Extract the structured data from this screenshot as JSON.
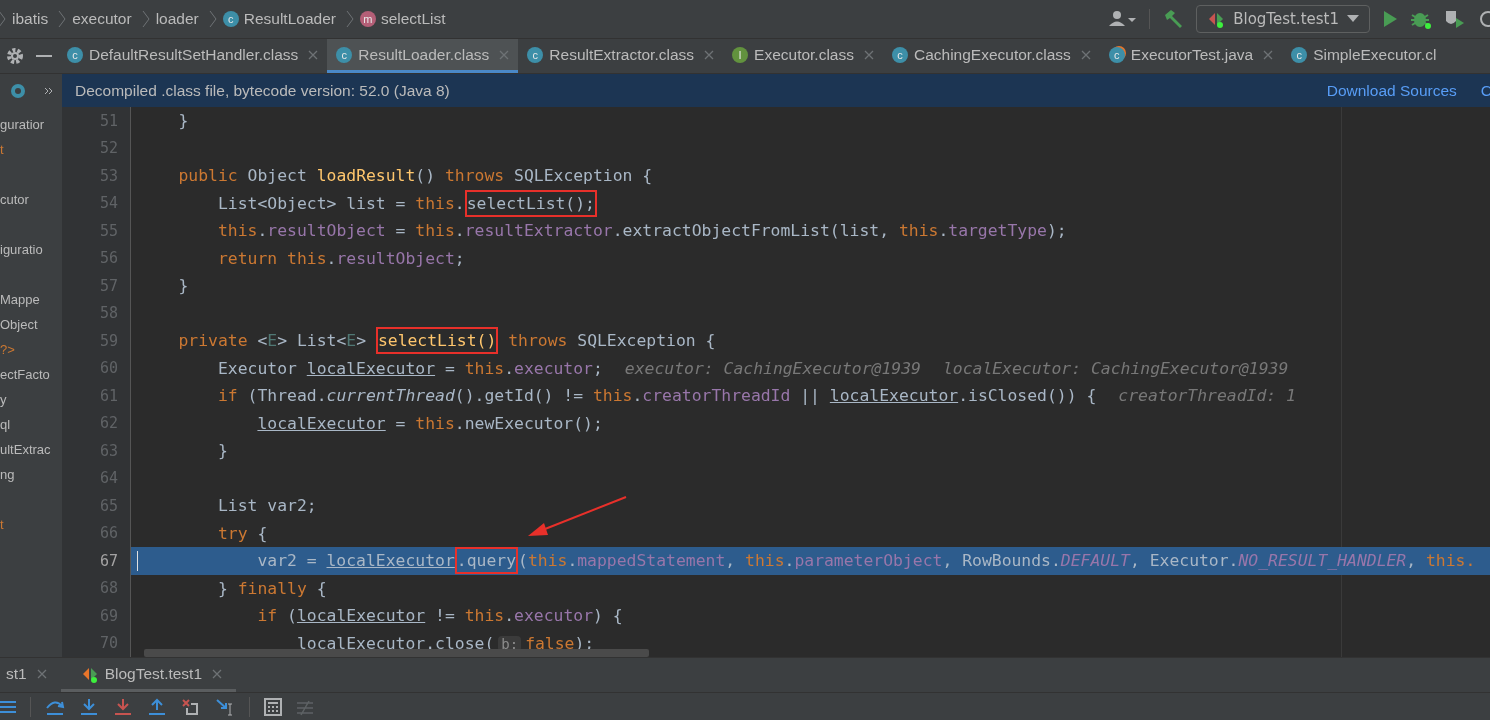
{
  "breadcrumbs": [
    {
      "label": "ibatis",
      "kind": "package"
    },
    {
      "label": "executor",
      "kind": "package"
    },
    {
      "label": "loader",
      "kind": "package"
    },
    {
      "label": "ResultLoader",
      "kind": "class",
      "icon_letter": "c"
    },
    {
      "label": "selectList",
      "kind": "method",
      "icon_letter": "m"
    }
  ],
  "run_config": {
    "label": "BlogTest.test1"
  },
  "tabs": [
    {
      "label": "DefaultResultSetHandler.class",
      "kind": "class",
      "icon_letter": "c",
      "selected": false,
      "closable": true
    },
    {
      "label": "ResultLoader.class",
      "kind": "class",
      "icon_letter": "c",
      "selected": true,
      "closable": true
    },
    {
      "label": "ResultExtractor.class",
      "kind": "class",
      "icon_letter": "c",
      "selected": false,
      "closable": true
    },
    {
      "label": "Executor.class",
      "kind": "interface",
      "icon_letter": "I",
      "selected": false,
      "closable": true
    },
    {
      "label": "CachingExecutor.class",
      "kind": "class",
      "icon_letter": "c",
      "selected": false,
      "closable": true
    },
    {
      "label": "ExecutorTest.java",
      "kind": "test",
      "icon_letter": "c",
      "selected": false,
      "closable": true
    },
    {
      "label": "SimpleExecutor.cl",
      "kind": "class",
      "icon_letter": "c",
      "selected": false,
      "closable": false
    }
  ],
  "banner": {
    "message": "Decompiled .class file, bytecode version: 52.0 (Java 8)",
    "links": [
      "Download Sources",
      "C"
    ]
  },
  "sidebar": {
    "items": [
      "guratior",
      "t",
      "cutor",
      "iguratio",
      "Mappe",
      "Object",
      "?>",
      "ectFacto",
      "y",
      "ql",
      "ultExtrac",
      "ng",
      "t"
    ]
  },
  "editor": {
    "lines": [
      {
        "number": "51",
        "current": false,
        "tokens": [
          {
            "text": "    }",
            "kind": "plain"
          }
        ]
      },
      {
        "number": "52",
        "current": false
      },
      {
        "number": "53",
        "current": false,
        "tokens": [
          {
            "text": "    public",
            "kind": "kw"
          },
          {
            "text": " Object ",
            "kind": "plain"
          },
          {
            "text": "loadResult",
            "kind": "fn"
          },
          {
            "text": "() ",
            "kind": "plain"
          },
          {
            "text": "throws",
            "kind": "kw"
          },
          {
            "text": " SQLException {",
            "kind": "plain"
          }
        ]
      },
      {
        "number": "54",
        "current": false,
        "tokens": [
          {
            "text": "        List<Object> list = ",
            "kind": "plain"
          },
          {
            "text": "this",
            "kind": "kw"
          },
          {
            "text": ".",
            "kind": "plain"
          },
          {
            "text": "selectList();",
            "kind": "box"
          }
        ]
      },
      {
        "number": "55",
        "current": false,
        "tokens": [
          {
            "text": "        this",
            "kind": "kw"
          },
          {
            "text": ".",
            "kind": "plain"
          },
          {
            "text": "resultObject",
            "kind": "field"
          },
          {
            "text": " = ",
            "kind": "plain"
          },
          {
            "text": "this",
            "kind": "kw"
          },
          {
            "text": ".",
            "kind": "plain"
          },
          {
            "text": "resultExtractor",
            "kind": "field"
          },
          {
            "text": ".extractObjectFromList(list, ",
            "kind": "plain"
          },
          {
            "text": "this",
            "kind": "kw"
          },
          {
            "text": ".",
            "kind": "plain"
          },
          {
            "text": "targetType",
            "kind": "field"
          },
          {
            "text": ");",
            "kind": "plain"
          }
        ]
      },
      {
        "number": "56",
        "current": false,
        "tokens": [
          {
            "text": "        return this",
            "kind": "kw"
          },
          {
            "text": ".",
            "kind": "plain"
          },
          {
            "text": "resultObject",
            "kind": "field"
          },
          {
            "text": ";",
            "kind": "plain"
          }
        ]
      },
      {
        "number": "57",
        "current": false,
        "tokens": [
          {
            "text": "    }",
            "kind": "plain"
          }
        ]
      },
      {
        "number": "58",
        "current": false
      },
      {
        "number": "59",
        "current": false,
        "tokens": [
          {
            "text": "    private",
            "kind": "kw"
          },
          {
            "text": " <",
            "kind": "plain"
          },
          {
            "text": "E",
            "kind": "type"
          },
          {
            "text": "> List<",
            "kind": "plain"
          },
          {
            "text": "E",
            "kind": "type"
          },
          {
            "text": "> ",
            "kind": "plain"
          },
          {
            "text": "selectList()",
            "kind": "fnbox"
          },
          {
            "text": " throws",
            "kind": "kw"
          },
          {
            "text": " SQLException {",
            "kind": "plain"
          }
        ]
      },
      {
        "number": "60",
        "current": false,
        "tokens": [
          {
            "text": "        Executor ",
            "kind": "plain"
          },
          {
            "text": "localExecutor",
            "kind": "local"
          },
          {
            "text": " = ",
            "kind": "plain"
          },
          {
            "text": "this",
            "kind": "kw"
          },
          {
            "text": ".",
            "kind": "plain"
          },
          {
            "text": "executor",
            "kind": "field"
          },
          {
            "text": ";",
            "kind": "plain"
          },
          {
            "text": "executor: CachingExecutor@1939",
            "kind": "hint"
          },
          {
            "text": "localExecutor: CachingExecutor@1939",
            "kind": "hint"
          }
        ]
      },
      {
        "number": "61",
        "current": false,
        "tokens": [
          {
            "text": "        if",
            "kind": "kw"
          },
          {
            "text": " (Thread.",
            "kind": "plain"
          },
          {
            "text": "currentThread",
            "kind": "italic"
          },
          {
            "text": "().getId() != ",
            "kind": "plain"
          },
          {
            "text": "this",
            "kind": "kw"
          },
          {
            "text": ".",
            "kind": "plain"
          },
          {
            "text": "creatorThreadId",
            "kind": "field"
          },
          {
            "text": " || ",
            "kind": "plain"
          },
          {
            "text": "localExecutor",
            "kind": "local"
          },
          {
            "text": ".isClosed()) {",
            "kind": "plain"
          },
          {
            "text": "creatorThreadId: 1",
            "kind": "hint"
          }
        ]
      },
      {
        "number": "62",
        "current": false,
        "tokens": [
          {
            "text": "            localExecutor",
            "kind": "local"
          },
          {
            "text": " = ",
            "kind": "plain"
          },
          {
            "text": "this",
            "kind": "kw"
          },
          {
            "text": ".newExecutor();",
            "kind": "plain"
          }
        ]
      },
      {
        "number": "63",
        "current": false,
        "tokens": [
          {
            "text": "        }",
            "kind": "plain"
          }
        ]
      },
      {
        "number": "64",
        "current": false
      },
      {
        "number": "65",
        "current": false,
        "tokens": [
          {
            "text": "        List var2;",
            "kind": "plain"
          }
        ]
      },
      {
        "number": "66",
        "current": false,
        "tokens": [
          {
            "text": "        try",
            "kind": "kw"
          },
          {
            "text": " {",
            "kind": "plain"
          }
        ]
      },
      {
        "number": "67",
        "current": true,
        "tokens": [
          {
            "text": "            var2 = ",
            "kind": "plain"
          },
          {
            "text": "localExecutor",
            "kind": "local"
          },
          {
            "text": ".query",
            "kind": "box"
          },
          {
            "text": "(",
            "kind": "plain"
          },
          {
            "text": "this",
            "kind": "kw"
          },
          {
            "text": ".",
            "kind": "plain"
          },
          {
            "text": "mappedStatement",
            "kind": "field"
          },
          {
            "text": ", ",
            "kind": "plain"
          },
          {
            "text": "this",
            "kind": "kw"
          },
          {
            "text": ".",
            "kind": "plain"
          },
          {
            "text": "parameterObject",
            "kind": "field"
          },
          {
            "text": ", RowBounds.",
            "kind": "plain"
          },
          {
            "text": "DEFAULT",
            "kind": "static"
          },
          {
            "text": ", Executor.",
            "kind": "plain"
          },
          {
            "text": "NO_RESULT_HANDLER",
            "kind": "static"
          },
          {
            "text": ", ",
            "kind": "plain"
          },
          {
            "text": "this.",
            "kind": "kw"
          }
        ]
      },
      {
        "number": "68",
        "current": false,
        "tokens": [
          {
            "text": "        } ",
            "kind": "plain"
          },
          {
            "text": "finally",
            "kind": "kw"
          },
          {
            "text": " {",
            "kind": "plain"
          }
        ]
      },
      {
        "number": "69",
        "current": false,
        "tokens": [
          {
            "text": "            if",
            "kind": "kw"
          },
          {
            "text": " (",
            "kind": "plain"
          },
          {
            "text": "localExecutor",
            "kind": "local"
          },
          {
            "text": " != ",
            "kind": "plain"
          },
          {
            "text": "this",
            "kind": "kw"
          },
          {
            "text": ".",
            "kind": "plain"
          },
          {
            "text": "executor",
            "kind": "field"
          },
          {
            "text": ") {",
            "kind": "plain"
          }
        ]
      },
      {
        "number": "70",
        "current": false,
        "tokens": [
          {
            "text": "                localExecutor",
            "kind": "local"
          },
          {
            "text": ".close(",
            "kind": "plain"
          },
          {
            "text": "b:",
            "kind": "param"
          },
          {
            "text": "false",
            "kind": "kw"
          },
          {
            "text": ");",
            "kind": "plain"
          }
        ]
      }
    ]
  },
  "bottom_tabs": [
    {
      "label": "st1",
      "selected": false
    },
    {
      "label": "BlogTest.test1",
      "selected": true
    }
  ]
}
